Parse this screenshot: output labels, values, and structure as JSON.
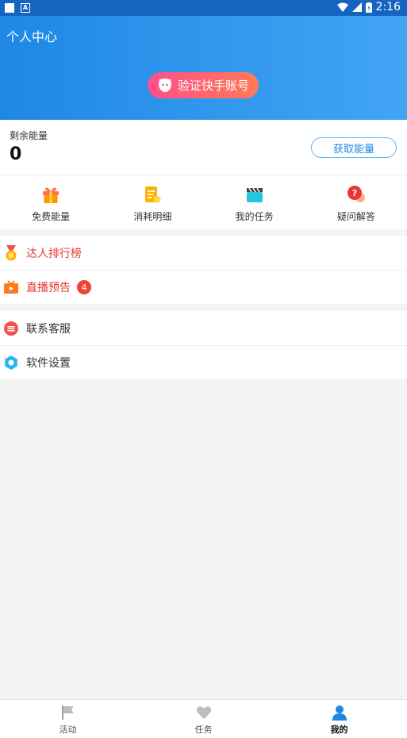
{
  "status": {
    "time": "2:16",
    "notif_letter": "A"
  },
  "header": {
    "title": "个人中心",
    "verify_label": "验证快手账号"
  },
  "energy": {
    "label": "剩余能量",
    "value": "0",
    "get_label": "获取能量"
  },
  "grid": [
    {
      "label": "免费能量",
      "icon": "gift-icon"
    },
    {
      "label": "消耗明细",
      "icon": "bill-icon"
    },
    {
      "label": "我的任务",
      "icon": "clapper-icon"
    },
    {
      "label": "疑问解答",
      "icon": "question-icon"
    }
  ],
  "group1": {
    "rank_label": "达人排行榜",
    "live_label": "直播预告",
    "live_badge": "4"
  },
  "group2": {
    "service_label": "联系客服",
    "settings_label": "软件设置"
  },
  "tabs": [
    {
      "label": "活动",
      "icon": "flag-icon"
    },
    {
      "label": "任务",
      "icon": "heart-icon"
    },
    {
      "label": "我的",
      "icon": "user-icon"
    }
  ],
  "colors": {
    "header": "#1e88e5",
    "accent_red": "#e53935",
    "link_blue": "#1e88e5"
  }
}
